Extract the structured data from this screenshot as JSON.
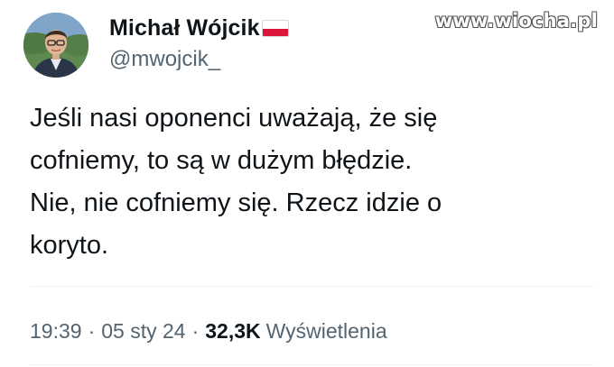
{
  "author": {
    "display_name": "Michał Wójcik",
    "handle": "@mwojcik_",
    "flag_icon": "poland-flag-icon",
    "avatar_icon": "profile-photo"
  },
  "watermark": "www.wiocha.pl",
  "tweet": {
    "lines": [
      "Jeśli nasi oponenci uważają, że się",
      "cofniemy, to są w dużym błędzie.",
      "Nie, nie cofniemy się. Rzecz idzie o",
      "koryto."
    ]
  },
  "meta": {
    "time": "19:39",
    "separator": "·",
    "date": "05 sty 24",
    "views_count": "32,3K",
    "views_label": "Wyświetlenia"
  },
  "colors": {
    "text_primary": "#0f1419",
    "text_secondary": "#536471",
    "divider": "#eff3f4",
    "flag_white": "#ffffff",
    "flag_red": "#dc143c"
  }
}
